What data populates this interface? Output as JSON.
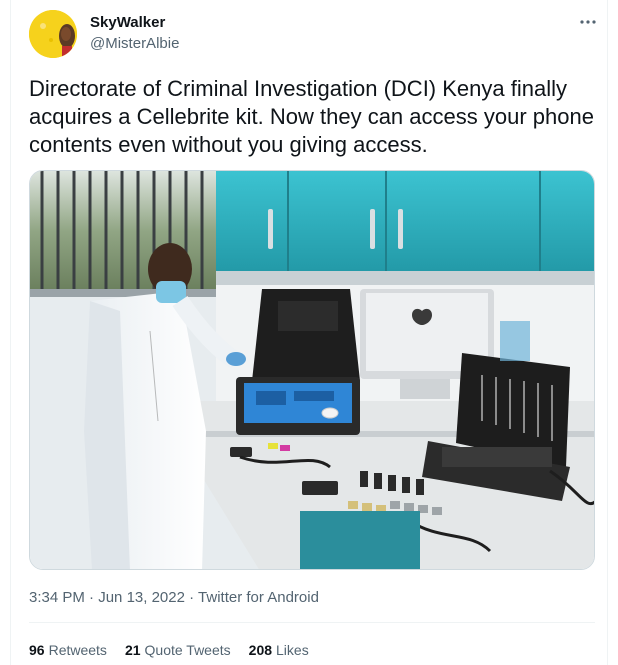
{
  "author": {
    "display_name": "SkyWalker",
    "handle": "@MisterAlbie",
    "avatar_bg": "#f6d21c"
  },
  "menu": {
    "icon": "more-horizontal-icon"
  },
  "tweet": {
    "text": "Directorate of Criminal Investigation (DCI) Kenya finally acquires a Cellebrite kit. Now they can access your phone contents even without you giving access.",
    "time": "3:34 PM",
    "date": "Jun 13, 2022",
    "separator": "·",
    "source": "Twitter for Android"
  },
  "stats": {
    "retweets_count": "96",
    "retweets_label": "Retweets",
    "quotes_count": "21",
    "quotes_label": "Quote Tweets",
    "likes_count": "208",
    "likes_label": "Likes"
  },
  "colors": {
    "text_primary": "#0f1419",
    "text_secondary": "#536471",
    "border": "#eff3f4",
    "cabinet": "#2fb5c4"
  }
}
